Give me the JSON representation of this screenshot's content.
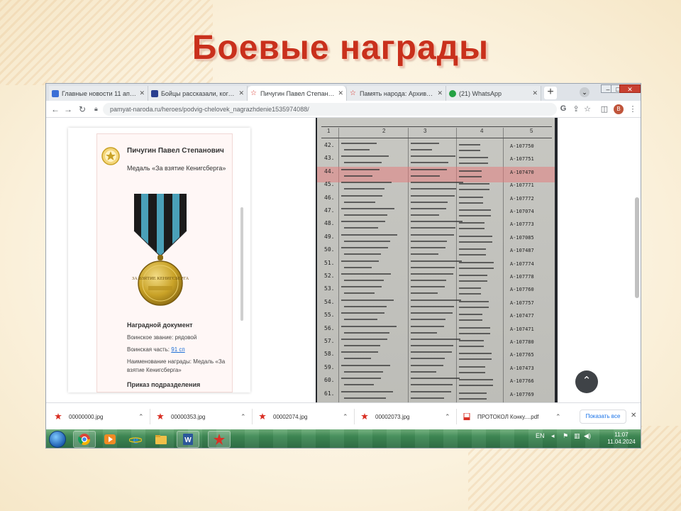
{
  "slide": {
    "title": "Боевые награды"
  },
  "browser": {
    "tabs": [
      {
        "label": "Главные новости 11 апреля",
        "color": "#3b6fd6",
        "active": false
      },
      {
        "label": "Бойцы рассказали, когда зако",
        "color": "#2a3f8f",
        "active": false
      },
      {
        "label": "Пичугин Павел Степанович",
        "color": "#d93025",
        "active": true
      },
      {
        "label": "Память народа: Архивы учет",
        "color": "#d93025",
        "active": false
      },
      {
        "label": "(21) WhatsApp",
        "color": "#25a244",
        "active": false
      }
    ],
    "new_tab": "+",
    "address": "pamyat-naroda.ru/heroes/podvig-chelovek_nagrazhdenie1535974088/",
    "window_controls": {
      "minimize": "–",
      "maximize": "□",
      "close": "✕"
    },
    "profile_initial": "B"
  },
  "card": {
    "person_name": "Пичугин Павел Степанович",
    "medal_name": "Медаль «За взятие Кенигсберга»",
    "medal_face_text": "ЗА ВЗЯТИЕ КЕНИГСБЕРГА",
    "doc_heading": "Наградной документ",
    "rank_line": "Воинское звание: рядовой",
    "unit_label": "Воинская часть: ",
    "unit_value": "91 сп",
    "award_line": "Наименование награды: Медаль «За взятие Кенигсберга»",
    "order_heading": "Приказ подразделения"
  },
  "doc": {
    "header_numbers": [
      "1",
      "2",
      "3",
      "4",
      "5"
    ],
    "rows": [
      {
        "n": "42.",
        "id": "А-107750",
        "hl": false
      },
      {
        "n": "43.",
        "id": "А-107751",
        "hl": false
      },
      {
        "n": "44.",
        "id": "А-107470",
        "hl": true
      },
      {
        "n": "45.",
        "id": "А-107771",
        "hl": false
      },
      {
        "n": "46.",
        "id": "А-107772",
        "hl": false
      },
      {
        "n": "47.",
        "id": "А-107074",
        "hl": false
      },
      {
        "n": "48.",
        "id": "А-107773",
        "hl": false
      },
      {
        "n": "49.",
        "id": "А-107085",
        "hl": false
      },
      {
        "n": "50.",
        "id": "А-107487",
        "hl": false
      },
      {
        "n": "51.",
        "id": "А-107774",
        "hl": false
      },
      {
        "n": "52.",
        "id": "А-107778",
        "hl": false
      },
      {
        "n": "53.",
        "id": "А-107760",
        "hl": false
      },
      {
        "n": "54.",
        "id": "А-107757",
        "hl": false
      },
      {
        "n": "55.",
        "id": "А-107477",
        "hl": false
      },
      {
        "n": "56.",
        "id": "А-107471",
        "hl": false
      },
      {
        "n": "57.",
        "id": "А-107780",
        "hl": false
      },
      {
        "n": "58.",
        "id": "А-107765",
        "hl": false
      },
      {
        "n": "59.",
        "id": "А-107473",
        "hl": false
      },
      {
        "n": "60.",
        "id": "А-107766",
        "hl": false
      },
      {
        "n": "61.",
        "id": "А-107769",
        "hl": false
      }
    ]
  },
  "downloads": {
    "items": [
      "00000000.jpg",
      "00000353.jpg",
      "00002074.jpg",
      "00002073.jpg",
      "ПРОТОКОЛ Конку....pdf"
    ],
    "show_all": "Показать все"
  },
  "taskbar": {
    "tray_lang": "EN",
    "time": "11:07",
    "date": "11.04.2024"
  },
  "colors": {
    "title_red": "#c9301c",
    "highlight_row": "#e67878",
    "ribbon_black": "#1b1b1b",
    "ribbon_blue": "#4aa0b8",
    "medal_gold": "#c9a227"
  }
}
